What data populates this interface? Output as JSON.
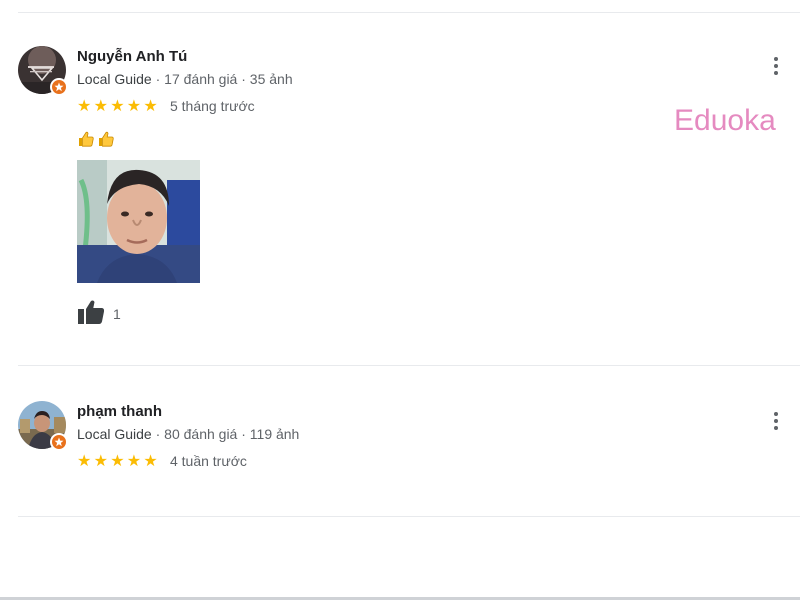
{
  "reviews": [
    {
      "name": "Nguyễn Anh Tú",
      "guide_label": "Local Guide",
      "stats": " · 17 đánh giá · 35 ảnh",
      "stars": 5,
      "date": "5 tháng trước",
      "text_icons": [
        "thumbs-up-emoji",
        "thumbs-up-emoji"
      ],
      "has_photo": true,
      "likes": "1"
    },
    {
      "name": "phạm thanh",
      "guide_label": "Local Guide",
      "stats": " · 80 đánh giá · 119 ảnh",
      "stars": 5,
      "date": "4 tuần trước",
      "text_icons": [],
      "has_photo": false,
      "likes": ""
    }
  ],
  "watermark": {
    "text": "Eduoka",
    "color": "#e58ac0"
  },
  "icons": {
    "star": "star-icon",
    "more": "more-vert-icon",
    "like": "thumb-up-icon",
    "badge": "local-guide-badge-icon"
  },
  "colors": {
    "star": "#fbbc04",
    "badge": "#e8711c",
    "secondary_text": "#5f6368"
  }
}
